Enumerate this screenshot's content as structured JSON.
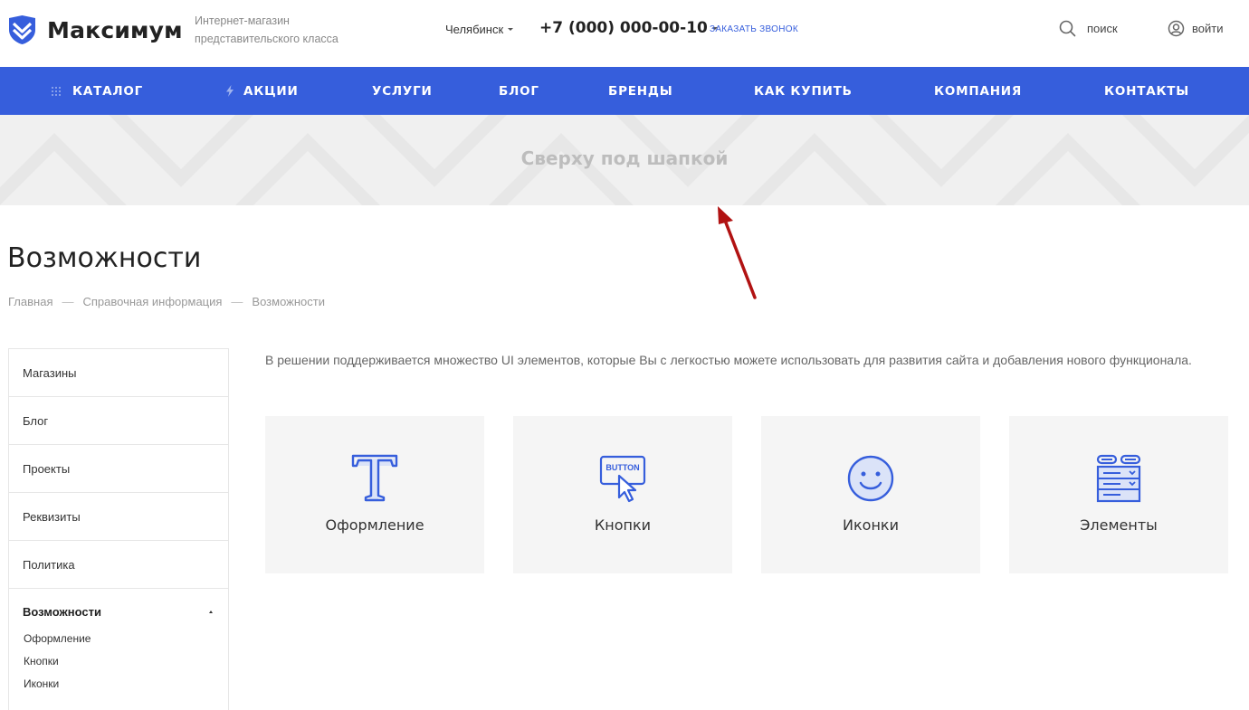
{
  "header": {
    "logo_text": "Максимум",
    "tagline_line1": "Интернет-магазин",
    "tagline_line2": "представительского класса",
    "city": "Челябинск",
    "phone": "+7 (000) 000-00-10",
    "callback": "ЗАКАЗАТЬ ЗВОНОК",
    "search_label": "поиск",
    "login_label": "войти",
    "brand_color": "#365edc"
  },
  "nav": {
    "items": [
      {
        "label": "КАТАЛОГ",
        "icon": "grid-icon"
      },
      {
        "label": "АКЦИИ",
        "icon": "lightning-icon"
      },
      {
        "label": "УСЛУГИ"
      },
      {
        "label": "БЛОГ"
      },
      {
        "label": "БРЕНДЫ"
      },
      {
        "label": "КАК КУПИТЬ"
      },
      {
        "label": "КОМПАНИЯ"
      },
      {
        "label": "КОНТАКТЫ"
      }
    ]
  },
  "banner": {
    "text": "Сверху под шапкой"
  },
  "page": {
    "title": "Возможности",
    "breadcrumb": [
      "Главная",
      "Справочная информация",
      "Возможности"
    ],
    "intro": "В решении поддерживается множество UI элементов, которые Вы с легкостью можете использовать для развития сайта и добавления нового функционала."
  },
  "sidebar": {
    "items": [
      "Магазины",
      "Блог",
      "Проекты",
      "Реквизиты",
      "Политика"
    ],
    "active": "Возможности",
    "sub_items": [
      "Оформление",
      "Кнопки",
      "Иконки"
    ]
  },
  "cards": [
    {
      "label": "Оформление",
      "icon": "typography-icon"
    },
    {
      "label": "Кнопки",
      "icon": "button-cursor-icon",
      "icon_text": "BUTTON"
    },
    {
      "label": "Иконки",
      "icon": "smiley-icon"
    },
    {
      "label": "Элементы",
      "icon": "form-elements-icon"
    }
  ]
}
